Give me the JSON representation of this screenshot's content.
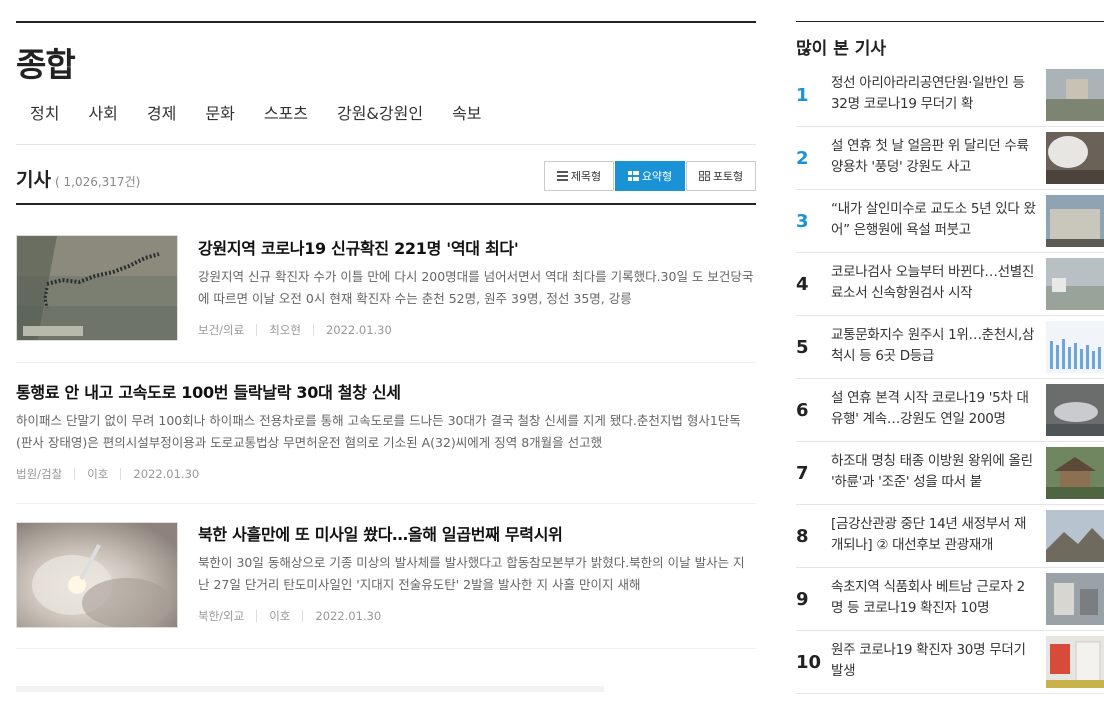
{
  "section": {
    "title": "종합",
    "categories": [
      "정치",
      "사회",
      "경제",
      "문화",
      "스포츠",
      "강원&강원인",
      "속보"
    ]
  },
  "list": {
    "title": "기사",
    "count": "( 1,026,317건)",
    "views": {
      "title_view": "제목형",
      "summary_view": "요약형",
      "photo_view": "포토형"
    }
  },
  "articles": [
    {
      "headline": "강원지역 코로나19 신규확진 221명 '역대 최다'",
      "summary": "강원지역 신규 확진자 수가 이틀 만에 다시 200명대를 넘어서면서 역대 최다를 기록했다.30일 도 보건당국에 따르면 이날 오전 0시 현재 확진자 수는 춘천 52명, 원주 39명, 정선 35명, 강릉",
      "category": "보건/의료",
      "author": "최오현",
      "date": "2022.01.30"
    },
    {
      "headline": "통행료 안 내고 고속도로 100번 들락날락 30대 철창 신세",
      "summary": "하이패스 단말기 없이 무려 100회나 하이패스 전용차로를 통해 고속도로를 드나든 30대가 결국 철창 신세를 지게 됐다.춘천지법 형사1단독(판사 장태영)은 편의시설부정이용과 도로교통법상 무면허운전 혐의로 기소된 A(32)씨에게 징역 8개월을 선고했",
      "category": "법원/검찰",
      "author": "이호",
      "date": "2022.01.30"
    },
    {
      "headline": "북한 사흘만에 또 미사일 쐈다…올해 일곱번째 무력시위",
      "summary": "북한이 30일 동해상으로 기종 미상의 발사체를 발사했다고 합동참모본부가 밝혔다.북한의 이날 발사는 지난 27일 단거리 탄도미사일인 '지대지 전술유도탄' 2발을 발사한 지 사흘 만이지 새해",
      "category": "북한/외교",
      "author": "이호",
      "date": "2022.01.30"
    }
  ],
  "most_read": {
    "title": "많이 본 기사",
    "items": [
      {
        "rank": "1",
        "title": "정선 아리아라리공연단원·일반인 등 32명 코로나19 무더기 확"
      },
      {
        "rank": "2",
        "title": "설 연휴 첫 날 얼음판 위 달리던 수륙양용차 '풍덩' 강원도 사고"
      },
      {
        "rank": "3",
        "title": "“내가 살인미수로 교도소 5년 있다 왔어” 은행원에 욕설 퍼붓고"
      },
      {
        "rank": "4",
        "title": "코로나검사 오늘부터 바뀐다…선별진료소서 신속항원검사 시작"
      },
      {
        "rank": "5",
        "title": "교통문화지수 원주시 1위…춘천시,삼척시 등 6곳 D등급"
      },
      {
        "rank": "6",
        "title": "설 연휴 본격 시작 코로나19 '5차 대유행' 계속…강원도 연일 200명"
      },
      {
        "rank": "7",
        "title": "하조대 명칭 태종 이방원 왕위에 올린 '하륜'과 '조준' 성을 따서 붙"
      },
      {
        "rank": "8",
        "title": "[금강산관광 중단 14년 새정부서 재개되나] ② 대선후보 관광재개"
      },
      {
        "rank": "9",
        "title": "속초지역 식품회사 베트남 근로자 2명 등 코로나19 확진자 10명"
      },
      {
        "rank": "10",
        "title": "원주 코로나19 확진자 30명 무더기 발생"
      }
    ]
  }
}
